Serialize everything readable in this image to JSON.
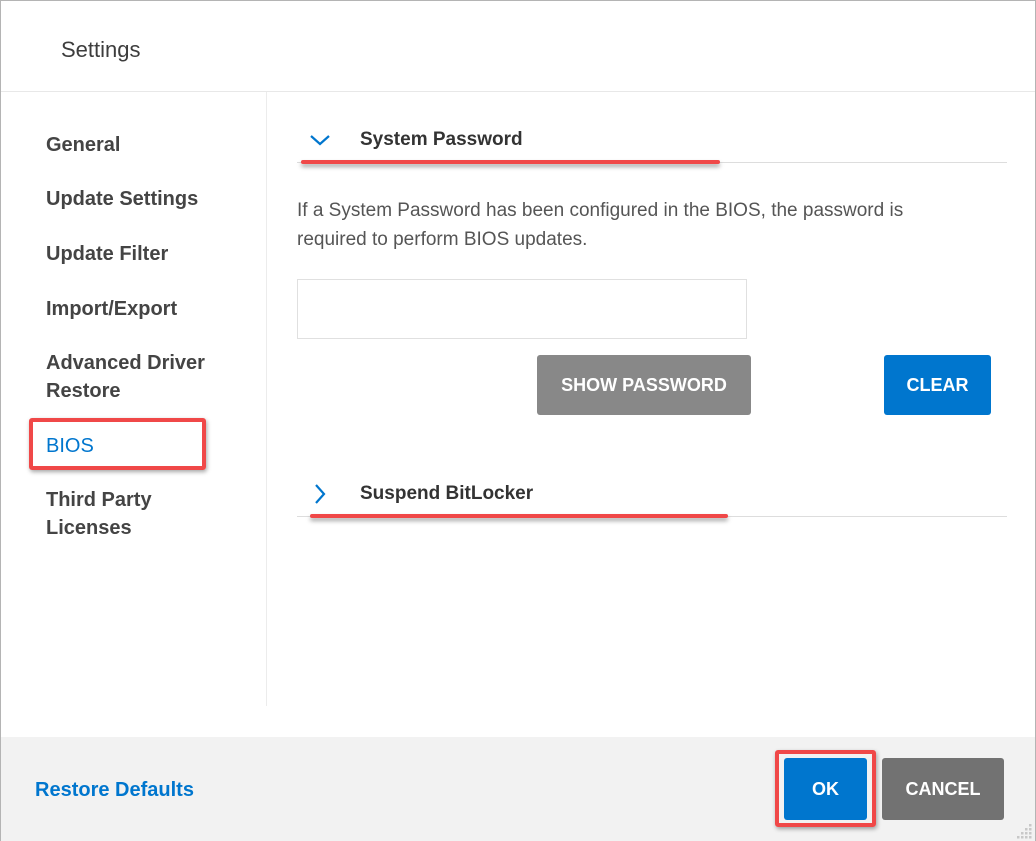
{
  "window": {
    "title": "Settings"
  },
  "sidebar": {
    "items": [
      {
        "label": "General",
        "active": false
      },
      {
        "label": "Update Settings",
        "active": false
      },
      {
        "label": "Update Filter",
        "active": false
      },
      {
        "label": "Import/Export",
        "active": false
      },
      {
        "label": "Advanced Driver",
        "label2": "Restore",
        "active": false
      },
      {
        "label": "BIOS",
        "active": true
      },
      {
        "label": "Third Party",
        "label2": "Licenses",
        "active": false
      }
    ]
  },
  "main": {
    "system_password": {
      "title": "System Password",
      "expanded": true,
      "icon": "chevron-down-icon",
      "description_line1": "If a System Password has been configured in the BIOS, the password is",
      "description_line2": "required to perform BIOS updates.",
      "input_value": "",
      "show_password_label": "SHOW PASSWORD",
      "clear_label": "CLEAR"
    },
    "suspend_bitlocker": {
      "title": "Suspend BitLocker",
      "expanded": false,
      "icon": "chevron-right-icon"
    }
  },
  "footer": {
    "restore_defaults_label": "Restore Defaults",
    "ok_label": "OK",
    "cancel_label": "CANCEL"
  },
  "colors": {
    "accent": "#0076ce",
    "secondary_button": "#888888",
    "cancel_button": "#727272",
    "annotation_red": "#f04848",
    "footer_bg": "#f2f2f2"
  }
}
